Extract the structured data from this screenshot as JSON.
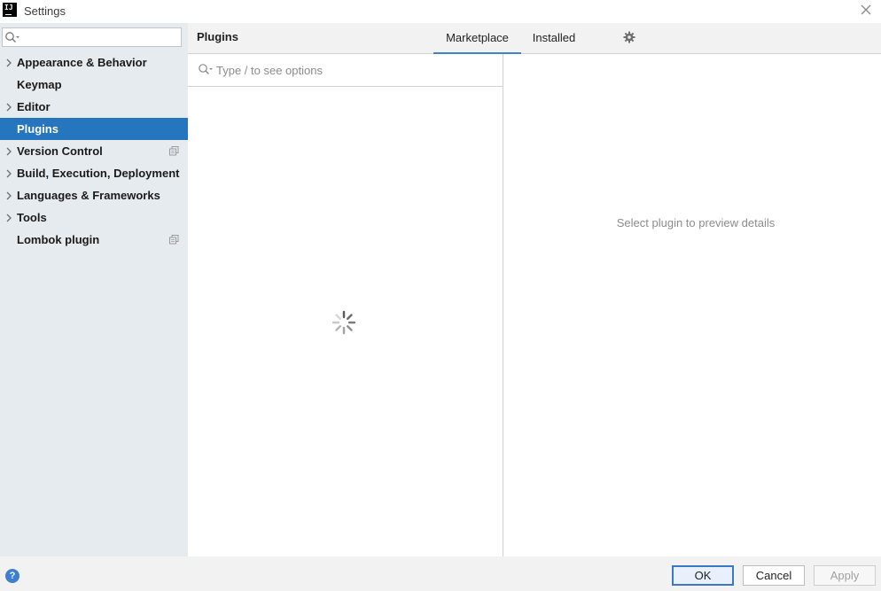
{
  "window": {
    "title": "Settings",
    "app_icon_text": "IJ"
  },
  "sidebar": {
    "search": {
      "value": "",
      "placeholder": ""
    },
    "items": [
      {
        "label": "Appearance & Behavior",
        "expandable": true,
        "project_icon": false,
        "selected": false
      },
      {
        "label": "Keymap",
        "expandable": false,
        "project_icon": false,
        "selected": false
      },
      {
        "label": "Editor",
        "expandable": true,
        "project_icon": false,
        "selected": false
      },
      {
        "label": "Plugins",
        "expandable": false,
        "project_icon": false,
        "selected": true
      },
      {
        "label": "Version Control",
        "expandable": true,
        "project_icon": true,
        "selected": false
      },
      {
        "label": "Build, Execution, Deployment",
        "expandable": true,
        "project_icon": false,
        "selected": false
      },
      {
        "label": "Languages & Frameworks",
        "expandable": true,
        "project_icon": false,
        "selected": false
      },
      {
        "label": "Tools",
        "expandable": true,
        "project_icon": false,
        "selected": false
      },
      {
        "label": "Lombok plugin",
        "expandable": false,
        "project_icon": true,
        "selected": false
      }
    ]
  },
  "main": {
    "title": "Plugins",
    "tabs": [
      {
        "label": "Marketplace",
        "active": true
      },
      {
        "label": "Installed",
        "active": false
      }
    ],
    "settings_icon": "gear-icon",
    "plugin_search": {
      "value": "",
      "placeholder": "Type / to see options"
    },
    "loading": true,
    "details_empty_text": "Select plugin to preview details"
  },
  "footer": {
    "help_label": "?",
    "ok_label": "OK",
    "cancel_label": "Cancel",
    "apply_label": "Apply",
    "apply_enabled": false
  },
  "colors": {
    "selection": "#2675bf",
    "sidebar_bg": "#e6ebf0",
    "tab_underline": "#4083c9",
    "help_icon": "#3d7fd1"
  }
}
